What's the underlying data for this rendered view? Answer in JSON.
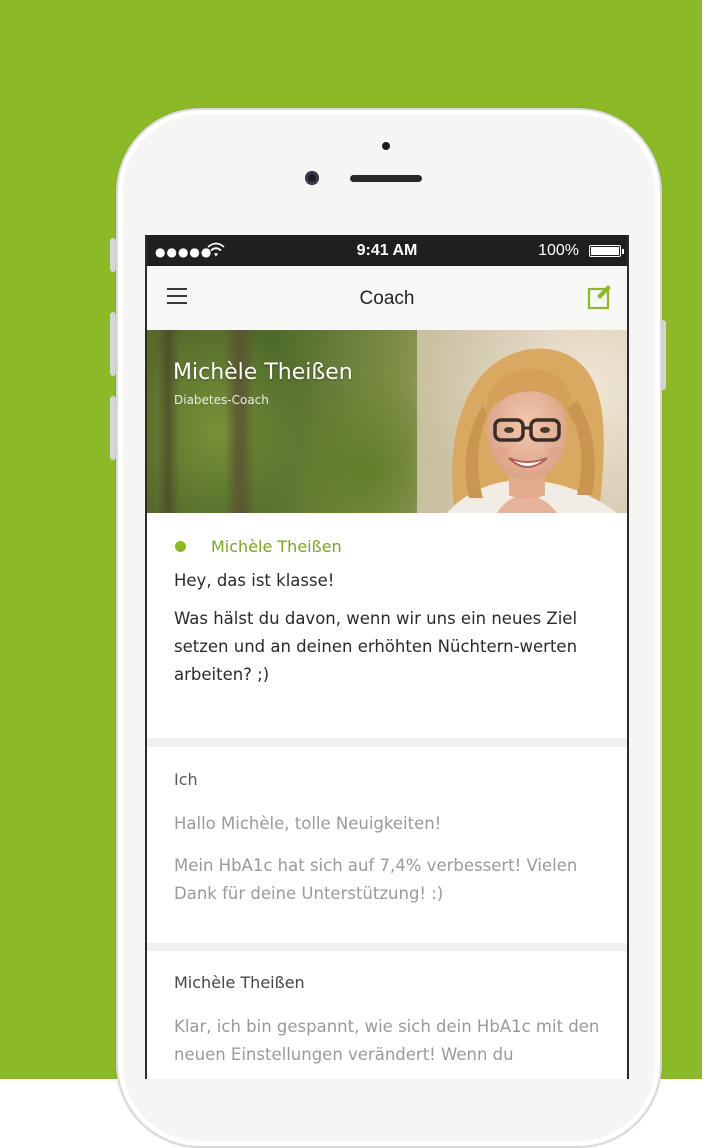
{
  "status_bar": {
    "signal": "●●●●●",
    "time": "9:41 AM",
    "battery": "100%",
    "wifi_icon": "wifi-icon",
    "battery_icon": "battery-icon"
  },
  "nav": {
    "title": "Coach",
    "menu_icon": "hamburger-menu-icon",
    "compose_icon": "compose-icon",
    "accent_color": "#8bb927"
  },
  "coach": {
    "name": "Michèle Theißen",
    "role": "Diabetes-Coach"
  },
  "messages": [
    {
      "author": "Michèle Theißen",
      "online": true,
      "lines": [
        "Hey, das ist klasse!",
        "Was hälst du davon, wenn wir uns ein neues Ziel setzen und an deinen erhöhten Nüchtern-werten arbeiten? ;)"
      ]
    },
    {
      "author": "Ich",
      "online": false,
      "lines": [
        "Hallo Michèle, tolle Neuigkeiten!",
        "Mein HbA1c hat sich auf 7,4% verbessert! Vielen Dank für deine Unterstützung! :)"
      ]
    },
    {
      "author": "Michèle Theißen",
      "online": false,
      "lines": [
        "Klar, ich bin gespannt, wie sich dein HbA1c mit den neuen Einstellungen verändert! Wenn du"
      ]
    }
  ],
  "colors": {
    "background_green": "#8bb927",
    "online_dot": "#8bbb22",
    "author_highlight": "#7aa428"
  }
}
